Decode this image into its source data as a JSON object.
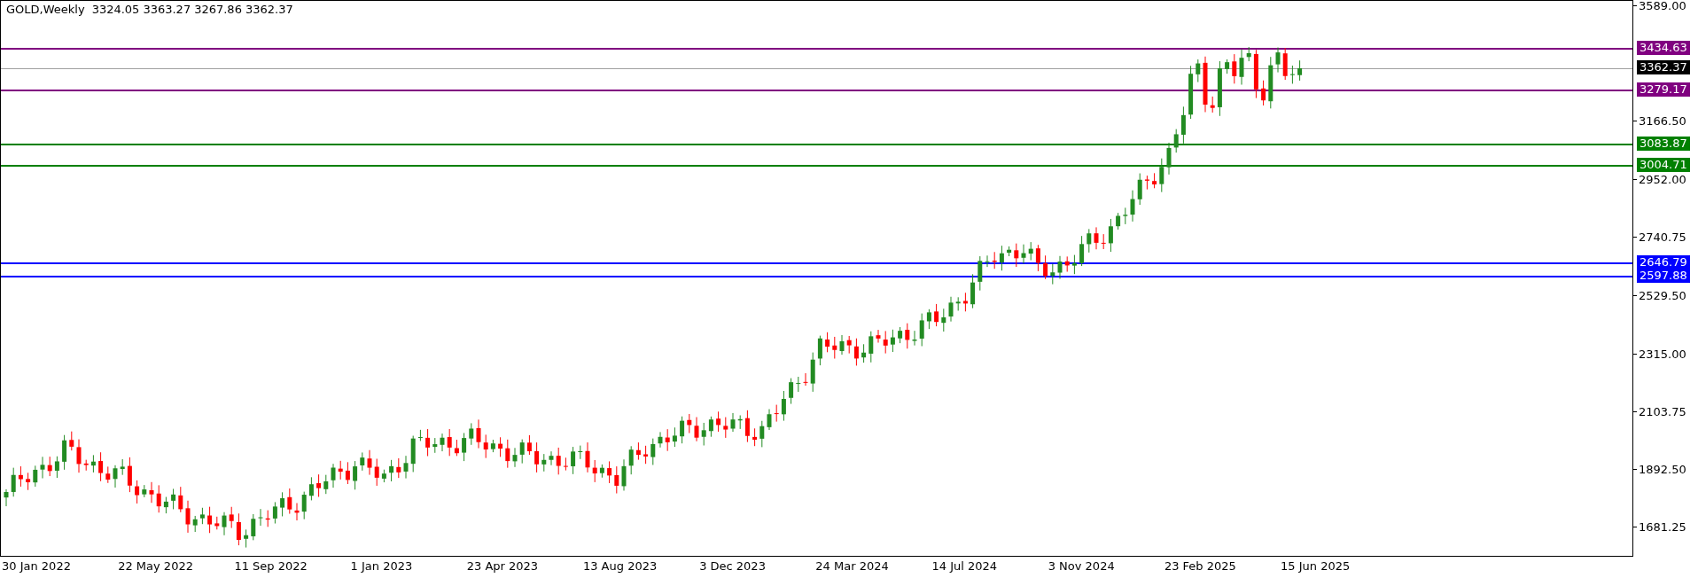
{
  "chart": {
    "symbol": "GOLD,Weekly",
    "ohlc": [
      "3324.05",
      "3363.27",
      "3267.86",
      "3362.37"
    ]
  },
  "price_ticks": [
    "3589.00",
    "3166.50",
    "2952.00",
    "2740.75",
    "2529.50",
    "2315.00",
    "2103.75",
    "1892.50",
    "1681.25"
  ],
  "levels": [
    {
      "label": "3434.63",
      "color": "#800080",
      "kind": "level"
    },
    {
      "label": "3362.37",
      "color": "#000000",
      "kind": "current"
    },
    {
      "label": "3279.17",
      "color": "#800080",
      "kind": "level"
    },
    {
      "label": "3083.87",
      "color": "#008000",
      "kind": "level"
    },
    {
      "label": "3004.71",
      "color": "#008000",
      "kind": "level"
    },
    {
      "label": "2646.79",
      "color": "#0000ff",
      "kind": "level"
    },
    {
      "label": "2597.88",
      "color": "#0000ff",
      "kind": "level"
    }
  ],
  "time_labels": [
    "30 Jan 2022",
    "22 May 2022",
    "11 Sep 2022",
    "1 Jan 2023",
    "23 Apr 2023",
    "13 Aug 2023",
    "3 Dec 2023",
    "24 Mar 2024",
    "14 Jul 2024",
    "3 Nov 2024",
    "23 Feb 2025",
    "15 Jun 2025"
  ]
}
